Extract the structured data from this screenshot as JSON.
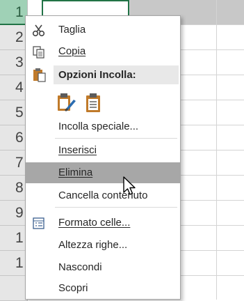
{
  "row_headers": [
    "1",
    "2",
    "3",
    "4",
    "5",
    "6",
    "7",
    "8",
    "9",
    "1",
    "1"
  ],
  "context_menu": {
    "cut": "Taglia",
    "copy": "Copia",
    "paste_options_header": "Opzioni Incolla:",
    "paste_special": "Incolla speciale...",
    "insert": "Inserisci",
    "delete": "Elimina",
    "clear_contents": "Cancella contenuto",
    "format_cells": "Formato celle...",
    "row_height": "Altezza righe...",
    "hide": "Nascondi",
    "unhide": "Scopri"
  },
  "icons": {
    "cut": "scissors-icon",
    "copy": "copy-icon",
    "paste": "clipboard-icon",
    "paste_formatting": "clipboard-brush-icon",
    "paste_values": "clipboard-icon",
    "format_cells": "format-cells-icon",
    "cursor": "mouse-pointer-icon"
  },
  "colors": {
    "selection_green": "#217346",
    "highlight": "#a7a7a7",
    "paste_clipboard": "#c07a2a"
  }
}
